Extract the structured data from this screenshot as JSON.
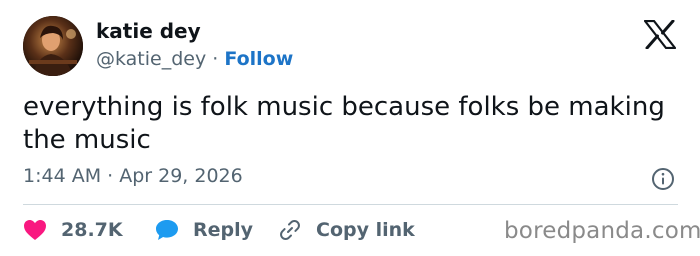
{
  "tweet": {
    "author": {
      "display_name": "katie dey",
      "handle": "@katie_dey",
      "separator": " · ",
      "follow_label": "Follow"
    },
    "text": "everything is folk music because folks be making\nthe music",
    "timestamp": "1:44 AM · Apr 29, 2026"
  },
  "actions": {
    "likes": "28.7K",
    "reply": "Reply",
    "copy_link": "Copy link"
  },
  "watermark": "boredpanda.com",
  "colors": {
    "text": "#0f1419",
    "secondary": "#536471",
    "link": "#1d74c7",
    "like": "#f91880",
    "reply": "#1d9bf0",
    "divider": "#cfd9de"
  },
  "icons": [
    "avatar-photo",
    "x-logo-icon",
    "info-icon",
    "heart-icon",
    "reply-bubble-icon",
    "link-icon"
  ]
}
